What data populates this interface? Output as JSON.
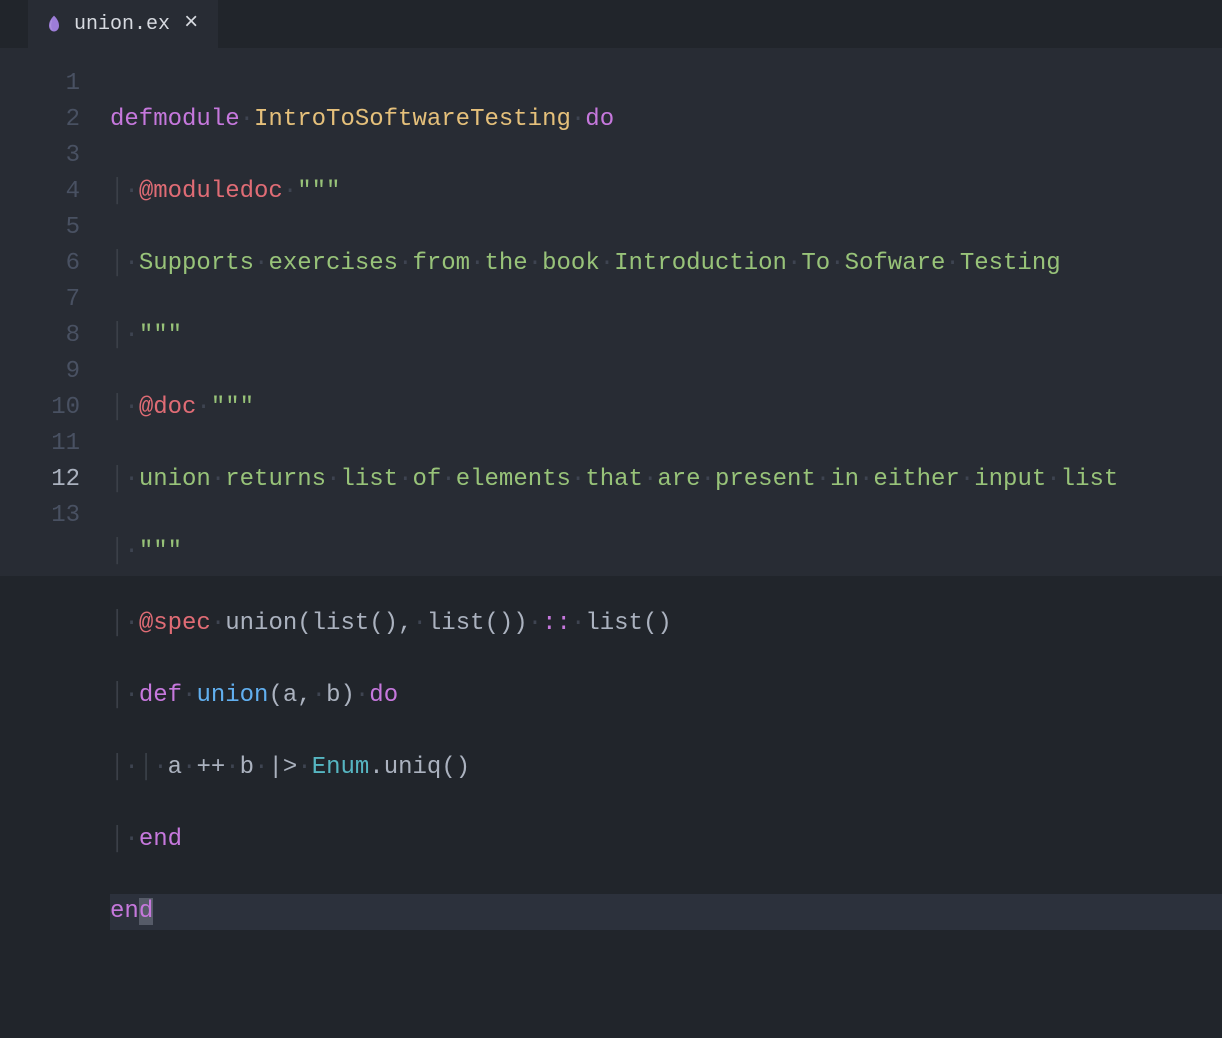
{
  "tab": {
    "filename": "union.ex"
  },
  "gutter": {
    "lines": [
      "1",
      "2",
      "3",
      "4",
      "5",
      "6",
      "7",
      "8",
      "9",
      "10",
      "11",
      "12",
      "13"
    ]
  },
  "code": {
    "l1": {
      "defmodule": "defmodule",
      "module": "IntroToSoftwareTesting",
      "do": "do"
    },
    "l2": {
      "attr": "@moduledoc",
      "quote": "\"\"\""
    },
    "l3": {
      "text": "Supports",
      "t2": "exercises",
      "t3": "from",
      "t4": "the",
      "t5": "book",
      "t6": "Introduction",
      "t7": "To",
      "t8": "Sofware",
      "t9": "Testing"
    },
    "l4": {
      "quote": "\"\"\""
    },
    "l5": {
      "attr": "@doc",
      "quote": "\"\"\""
    },
    "l6": {
      "t1": "union",
      "t2": "returns",
      "t3": "list",
      "t4": "of",
      "t5": "elements",
      "t6": "that",
      "t7": "are",
      "t8": "present",
      "t9": "in",
      "t10": "either",
      "t11": "input",
      "t12": "list"
    },
    "l7": {
      "quote": "\"\"\""
    },
    "l8": {
      "attr": "@spec",
      "fn": "union",
      "p1": "list",
      "p2": "list",
      "ret": "list",
      "dcol": "::"
    },
    "l9": {
      "def": "def",
      "fn": "union",
      "a": "a",
      "b": "b",
      "do": "do"
    },
    "l10": {
      "a": "a",
      "pp": "++",
      "b": "b",
      "pipe": "|>",
      "mod": "Enum",
      "dot": ".",
      "fn": "uniq"
    },
    "l11": {
      "end": "end"
    },
    "l12": {
      "en": "en",
      "d": "d"
    },
    "dot": "·"
  }
}
